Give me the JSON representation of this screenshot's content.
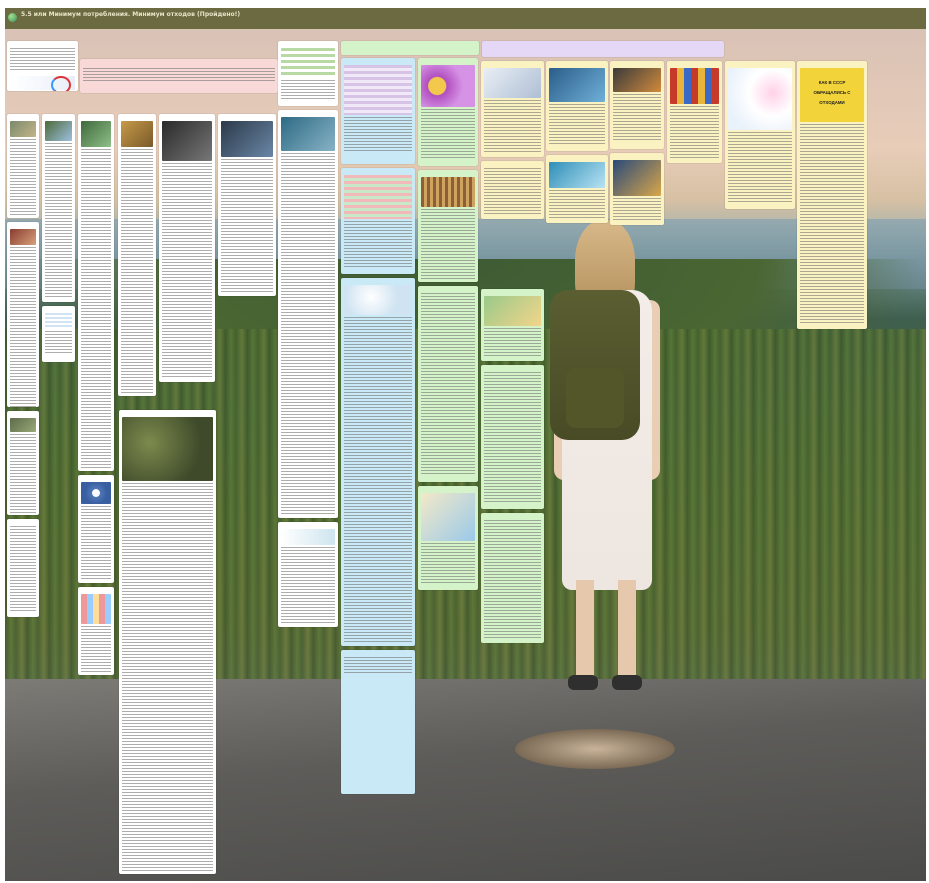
{
  "board": {
    "title": "5.5 или Минимум потребления. Минимум отходов (Пройдено!)",
    "subtitle": "",
    "logo_icon": "padlet-logo-icon"
  },
  "section_headers": {
    "pink": "",
    "green": "",
    "lilac": ""
  },
  "promo": {
    "caption": ""
  },
  "poster": {
    "text": "КАК В СССР ОБРАЩАЛИСЬ С ОТХОДАМИ"
  },
  "colors": {
    "topbar": "#6b6a41",
    "pink": "#f9d8d8",
    "green": "#d5f3c9",
    "blue": "#c9e9f6",
    "yellow": "#fbf2c2",
    "lilac": "#e4d8f6"
  }
}
